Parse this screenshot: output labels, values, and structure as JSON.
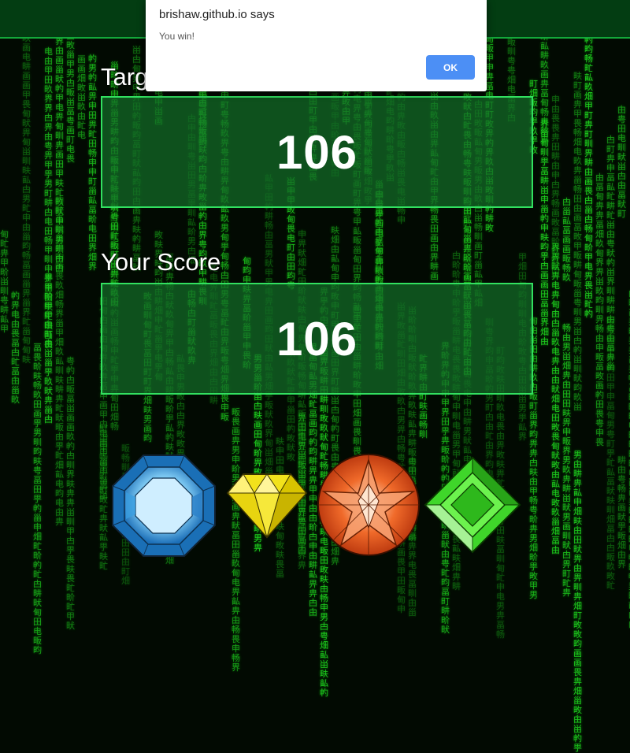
{
  "dialog": {
    "title": "brishaw.github.io says",
    "message": "You win!",
    "ok_label": "OK"
  },
  "game": {
    "target_label": "Target Score",
    "target_value": "106",
    "score_label": "Your Score",
    "score_value": "106"
  },
  "gems": [
    {
      "name": "blue-crystal",
      "color": "#2b8fd8"
    },
    {
      "name": "yellow-crystal",
      "color": "#f2e21c"
    },
    {
      "name": "red-crystal",
      "color": "#e0521c"
    },
    {
      "name": "green-crystal",
      "color": "#3fd62a"
    }
  ],
  "colors": {
    "rain": "#1fd41f",
    "box_border": "#32e060",
    "box_fill": "#146e28",
    "ok_button": "#4c8ff5"
  }
}
